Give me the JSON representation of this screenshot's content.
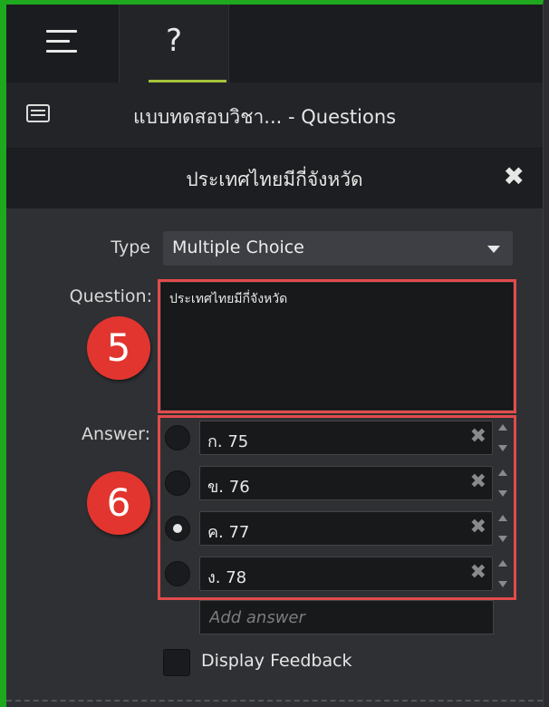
{
  "tabs": [
    {
      "icon": "hamburger-menu-icon"
    },
    {
      "icon": "help-icon",
      "label": "?"
    }
  ],
  "quiz_title": "แบบทดสอบวิชา... - Questions",
  "question_header": "ประเทศไทยมีกี่จังหวัด",
  "form": {
    "type_label": "Type",
    "type_value": "Multiple Choice",
    "question_label": "Question:",
    "question_value": "ประเทศไทยมีกี่จังหวัด",
    "answer_label": "Answer:",
    "answers": [
      {
        "text": "ก. 75",
        "selected": false
      },
      {
        "text": "ข. 76",
        "selected": false
      },
      {
        "text": "ค. 77",
        "selected": true
      },
      {
        "text": "ง. 78",
        "selected": false
      }
    ],
    "add_answer_placeholder": "Add answer",
    "display_feedback_label": "Display Feedback"
  },
  "callouts": [
    "5",
    "6"
  ],
  "colors": {
    "highlight": "#e24b4b",
    "badge": "#e2352f",
    "accent_green": "#1ea81e",
    "tab_underline": "#a5c43a"
  }
}
